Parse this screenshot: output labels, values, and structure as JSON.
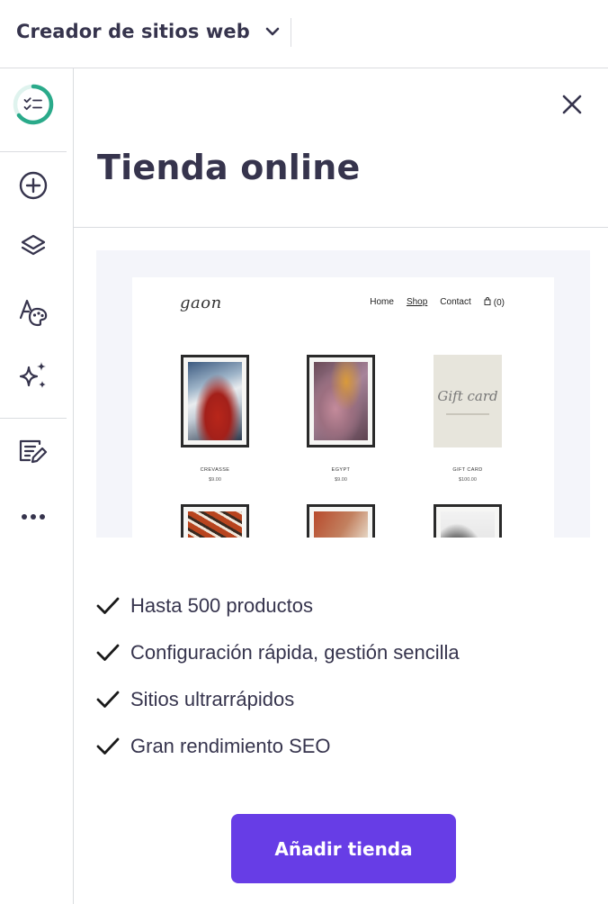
{
  "header": {
    "site_switcher_label": "Creador de sitios web",
    "chevron_icon": "chevron-down-icon"
  },
  "sidebar": {
    "items": [
      {
        "icon": "checklist-progress-icon"
      },
      {
        "icon": "add-circle-icon"
      },
      {
        "icon": "layers-icon"
      },
      {
        "icon": "styles-palette-icon"
      },
      {
        "icon": "ai-sparkles-icon"
      },
      {
        "icon": "edit-content-icon"
      },
      {
        "icon": "more-horizontal-icon"
      }
    ],
    "progress_color": "#00b090"
  },
  "panel": {
    "title": "Tienda online",
    "close_icon": "close-icon"
  },
  "preview": {
    "logo": "gaon",
    "nav": [
      "Home",
      "Shop",
      "Contact"
    ],
    "nav_active": "Shop",
    "cart_label": "(0)",
    "products": [
      {
        "name": "CREVASSE",
        "price": "$9.00"
      },
      {
        "name": "EGYPT",
        "price": "$9.00"
      },
      {
        "name": "GIFT CARD",
        "price": "$100.00"
      }
    ],
    "gift_text": "Gift card"
  },
  "features": [
    "Hasta 500 productos",
    "Configuración rápida, gestión sencilla",
    "Sitios ultrarrápidos",
    "Gran rendimiento SEO"
  ],
  "cta": {
    "label": "Añadir tienda"
  },
  "colors": {
    "accent": "#673de6",
    "text_dark": "#36344d",
    "border": "#dadce0"
  }
}
